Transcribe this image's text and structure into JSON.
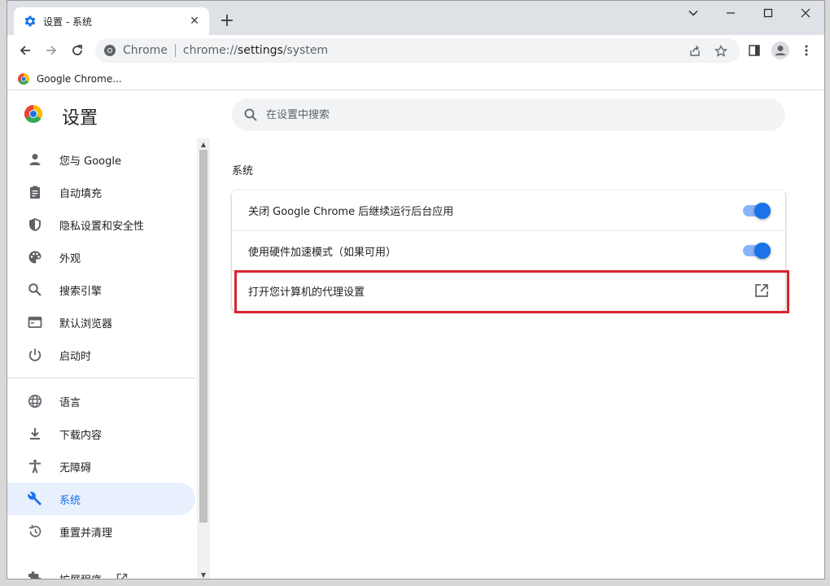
{
  "window": {
    "tab_title": "设置 - 系统",
    "close_tab": "✕",
    "new_tab": "+"
  },
  "toolbar": {
    "origin": "Chrome",
    "url_scheme": "chrome://",
    "url_host": "settings",
    "url_path": "/system"
  },
  "bookmarks": [
    {
      "label": "Google Chrome..."
    }
  ],
  "header": {
    "title": "设置"
  },
  "search": {
    "placeholder": "在设置中搜索"
  },
  "nav": {
    "items": [
      {
        "label": "您与 Google",
        "icon": "person-icon"
      },
      {
        "label": "自动填充",
        "icon": "clipboard-icon"
      },
      {
        "label": "隐私设置和安全性",
        "icon": "shield-icon"
      },
      {
        "label": "外观",
        "icon": "palette-icon"
      },
      {
        "label": "搜索引擎",
        "icon": "search-icon"
      },
      {
        "label": "默认浏览器",
        "icon": "browser-icon"
      },
      {
        "label": "启动时",
        "icon": "power-icon"
      },
      {
        "label": "语言",
        "icon": "globe-icon"
      },
      {
        "label": "下载内容",
        "icon": "download-icon"
      },
      {
        "label": "无障碍",
        "icon": "accessibility-icon"
      },
      {
        "label": "系统",
        "icon": "wrench-icon",
        "active": true
      },
      {
        "label": "重置并清理",
        "icon": "restore-icon"
      },
      {
        "label": "扩展程序",
        "icon": "extension-icon"
      }
    ]
  },
  "section": {
    "title": "系统",
    "rows": [
      {
        "label": "关闭 Google Chrome 后继续运行后台应用",
        "control": "toggle",
        "on": true
      },
      {
        "label": "使用硬件加速模式（如果可用）",
        "control": "toggle",
        "on": true
      },
      {
        "label": "打开您计算机的代理设置",
        "control": "external-link",
        "highlighted": true
      }
    ]
  },
  "background_peek": {
    "label": "启动时"
  },
  "colors": {
    "accent": "#1a73e8",
    "accent_light": "#8ab4f8",
    "active_nav_bg": "#e8f0fe",
    "highlight_border": "#d9232f"
  }
}
